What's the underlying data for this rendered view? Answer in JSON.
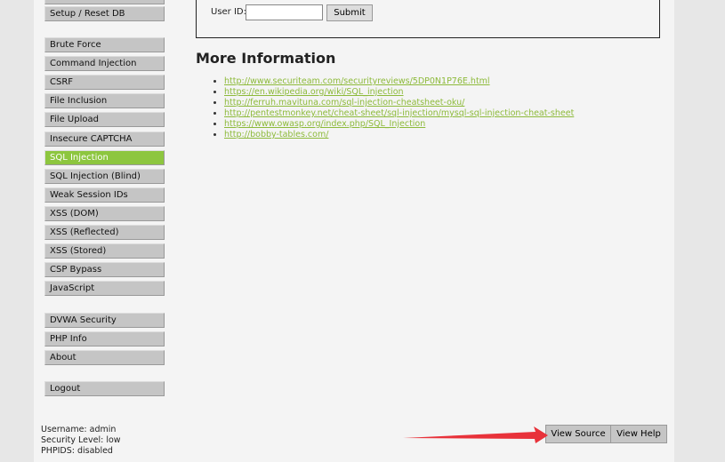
{
  "menu": {
    "setup": "Setup / Reset DB",
    "vulns": [
      "Brute Force",
      "Command Injection",
      "CSRF",
      "File Inclusion",
      "File Upload",
      "Insecure CAPTCHA",
      "SQL Injection",
      "SQL Injection (Blind)",
      "Weak Session IDs",
      "XSS (DOM)",
      "XSS (Reflected)",
      "XSS (Stored)",
      "CSP Bypass",
      "JavaScript"
    ],
    "selected": "SQL Injection",
    "other": [
      "DVWA Security",
      "PHP Info",
      "About"
    ],
    "logout": "Logout"
  },
  "form": {
    "label": "User ID:",
    "value": "",
    "submit": "Submit"
  },
  "info": {
    "title": "More Information",
    "links": [
      "http://www.securiteam.com/securityreviews/5DP0N1P76E.html",
      "https://en.wikipedia.org/wiki/SQL_injection",
      "http://ferruh.mavituna.com/sql-injection-cheatsheet-oku/",
      "http://pentestmonkey.net/cheat-sheet/sql-injection/mysql-sql-injection-cheat-sheet",
      "https://www.owasp.org/index.php/SQL_Injection",
      "http://bobby-tables.com/"
    ]
  },
  "footer": {
    "username": "Username: admin",
    "security": "Security Level: low",
    "phpids": "PHPIDS: disabled"
  },
  "buttons": {
    "view_source": "View Source",
    "view_help": "View Help"
  },
  "colors": {
    "accent": "#8dc63f",
    "arrow": "#e8323a"
  }
}
